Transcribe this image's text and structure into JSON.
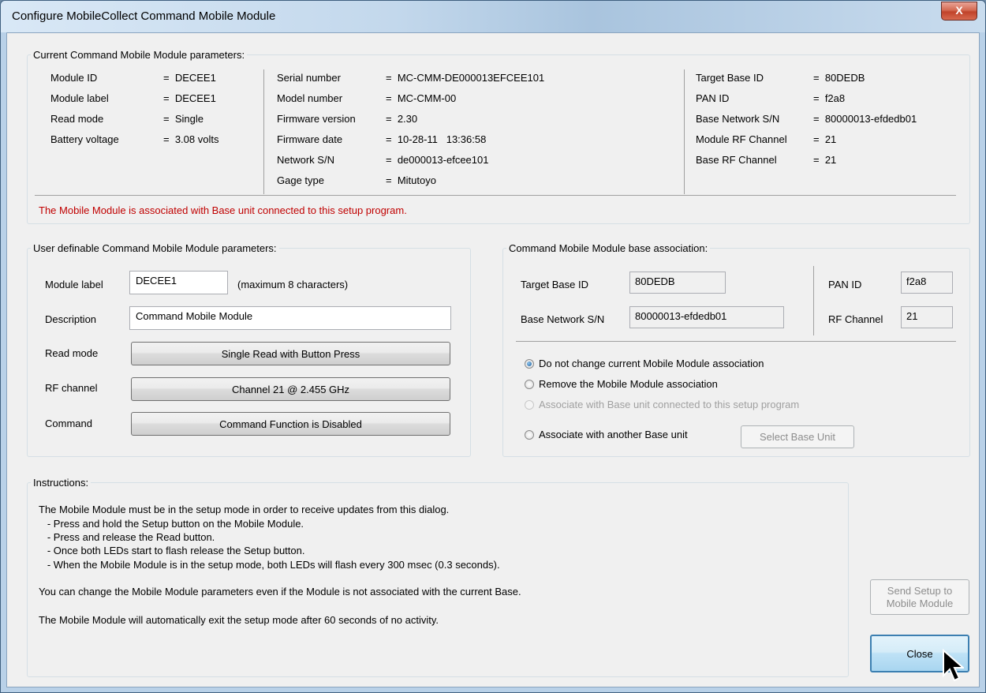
{
  "window": {
    "title": "Configure MobileCollect Command Mobile Module",
    "close_glyph": "X"
  },
  "current": {
    "legend": "Current Command Mobile Module parameters:",
    "col1": [
      {
        "label": "Module ID",
        "value": "=  DECEE1"
      },
      {
        "label": "Module label",
        "value": "=  DECEE1"
      },
      {
        "label": "Read mode",
        "value": "=  Single"
      },
      {
        "label": "Battery voltage",
        "value": "=  3.08 volts"
      }
    ],
    "col2": [
      {
        "label": "Serial number",
        "value": "=  MC-CMM-DE000013EFCEE101"
      },
      {
        "label": "Model number",
        "value": "=  MC-CMM-00"
      },
      {
        "label": "Firmware version",
        "value": "=  2.30"
      },
      {
        "label": "Firmware date",
        "value": "=  10-28-11   13:36:58"
      },
      {
        "label": "Network S/N",
        "value": "=  de000013-efcee101"
      },
      {
        "label": "Gage type",
        "value": "=  Mitutoyo"
      }
    ],
    "col3": [
      {
        "label": "Target Base ID",
        "value": "=  80DEDB"
      },
      {
        "label": "PAN ID",
        "value": "=  f2a8"
      },
      {
        "label": "Base Network S/N",
        "value": "=  80000013-efdedb01"
      },
      {
        "label": "Module RF Channel",
        "value": "=  21"
      },
      {
        "label": "Base RF Channel",
        "value": "=  21"
      }
    ],
    "status": "The Mobile Module is associated with Base unit connected to this setup program.",
    "status_color": "#c00000"
  },
  "user": {
    "legend": "User definable Command Mobile Module parameters:",
    "module_label": "Module label",
    "module_label_value": "DECEE1",
    "module_label_hint": "(maximum 8 characters)",
    "description": "Description",
    "description_value": "Command Mobile Module",
    "read_mode": "Read mode",
    "read_mode_button": "Single Read with Button Press",
    "rf_channel": "RF channel",
    "rf_channel_button": "Channel 21 @ 2.455 GHz",
    "command": "Command",
    "command_button": "Command Function is Disabled"
  },
  "assoc": {
    "legend": "Command Mobile Module base association:",
    "target_base_id_label": "Target Base ID",
    "target_base_id_value": "80DEDB",
    "pan_id_label": "PAN ID",
    "pan_id_value": "f2a8",
    "base_network_label": "Base Network S/N",
    "base_network_value": "80000013-efdedb01",
    "rf_channel_label": "RF Channel",
    "rf_channel_value": "21",
    "options": [
      {
        "label": "Do not change current Mobile Module association",
        "selected": true,
        "enabled": true
      },
      {
        "label": "Remove the Mobile Module association",
        "selected": false,
        "enabled": true
      },
      {
        "label": "Associate with Base unit connected to this setup program",
        "selected": false,
        "enabled": false
      },
      {
        "label": "Associate with another Base unit",
        "selected": false,
        "enabled": true
      }
    ],
    "select_base_button": "Select Base Unit"
  },
  "instructions": {
    "legend": "Instructions:",
    "lines": [
      "The Mobile Module must be in the setup mode in order to receive updates from this dialog.",
      "   - Press and hold the Setup button on the Mobile Module.",
      "   - Press and release the Read button.",
      "   - Once both LEDs start to flash release the Setup button.",
      "   - When the Mobile Module is in the setup mode, both LEDs will flash every 300 msec (0.3 seconds).",
      "You can change the Mobile Module parameters even if the Module is not associated with the current Base.",
      "The Mobile Module will automatically exit the setup mode after 60 seconds of no activity."
    ]
  },
  "buttons": {
    "send_setup_line1": "Send Setup to",
    "send_setup_line2": "Mobile Module",
    "close": "Close"
  }
}
